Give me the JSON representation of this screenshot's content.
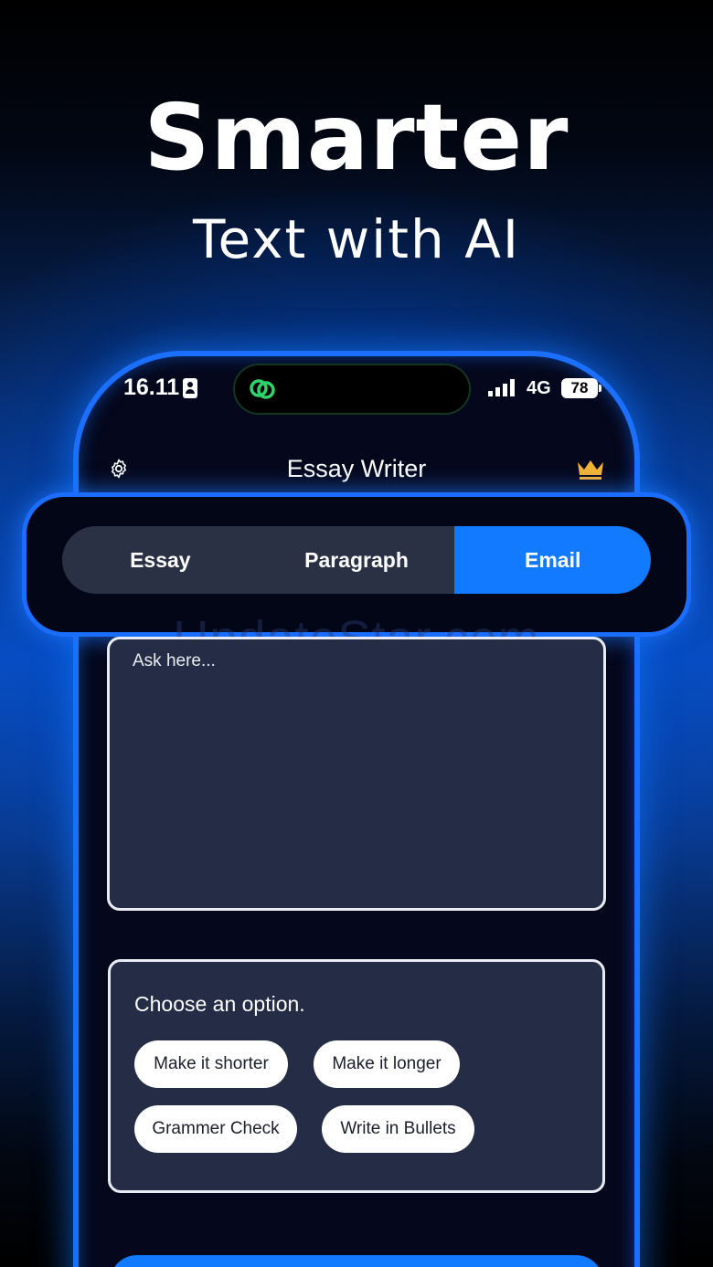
{
  "hero": {
    "title": "Smarter",
    "subtitle": "Text with AI"
  },
  "status_bar": {
    "time": "16.11",
    "network": "4G",
    "battery": "78"
  },
  "app_bar": {
    "title": "Essay Writer",
    "settings_icon": "gear-icon",
    "premium_icon": "crown-icon"
  },
  "tabs": [
    {
      "label": "Essay",
      "active": false
    },
    {
      "label": "Paragraph",
      "active": false
    },
    {
      "label": "Email",
      "active": true
    }
  ],
  "watermark": "UpdateStar.com",
  "prompt": {
    "placeholder": "Ask here..."
  },
  "options": {
    "title": "Choose an option.",
    "chips": [
      "Make it shorter",
      "Make it longer",
      "Grammer Check",
      "Write in Bullets"
    ]
  },
  "colors": {
    "accent": "#117aff",
    "card": "#242d45",
    "phone_bg": "#05081c",
    "crown": "#f5b335",
    "island_icon": "#2fd36a"
  }
}
